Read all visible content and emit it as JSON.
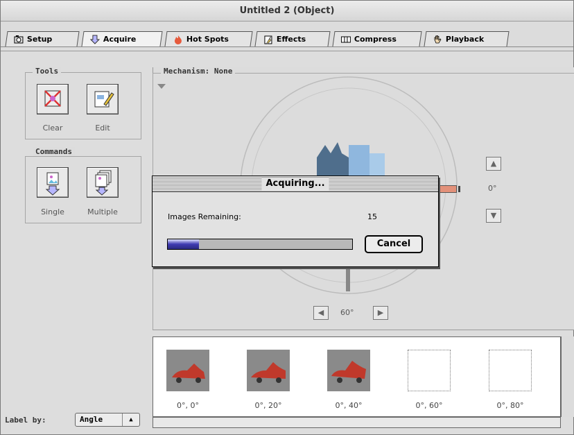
{
  "window": {
    "title": "Untitled 2 (Object)"
  },
  "tabs": [
    {
      "label": "Setup",
      "icon": "camera-icon"
    },
    {
      "label": "Acquire",
      "icon": "download-arrow-icon"
    },
    {
      "label": "Hot Spots",
      "icon": "hotspot-icon"
    },
    {
      "label": "Effects",
      "icon": "effects-icon"
    },
    {
      "label": "Compress",
      "icon": "film-icon"
    },
    {
      "label": "Playback",
      "icon": "hand-icon"
    }
  ],
  "tools": {
    "title": "Tools",
    "clear": "Clear",
    "edit": "Edit"
  },
  "commands": {
    "title": "Commands",
    "single": "Single",
    "multiple": "Multiple"
  },
  "mechanism": {
    "title": "Mechanism: None",
    "vertical_angle": "0°",
    "horizontal_angle": "60°"
  },
  "dialog": {
    "title": "Acquiring...",
    "images_label": "Images Remaining:",
    "images_count": "15",
    "cancel": "Cancel",
    "progress": 0.17
  },
  "thumbnails": [
    {
      "label": "0°, 0°",
      "filled": true
    },
    {
      "label": "0°, 20°",
      "filled": true
    },
    {
      "label": "0°, 40°",
      "filled": true
    },
    {
      "label": "0°, 60°",
      "filled": false
    },
    {
      "label": "0°, 80°",
      "filled": false
    }
  ],
  "footer": {
    "label_by": "Label by:",
    "label_by_value": "Angle"
  }
}
